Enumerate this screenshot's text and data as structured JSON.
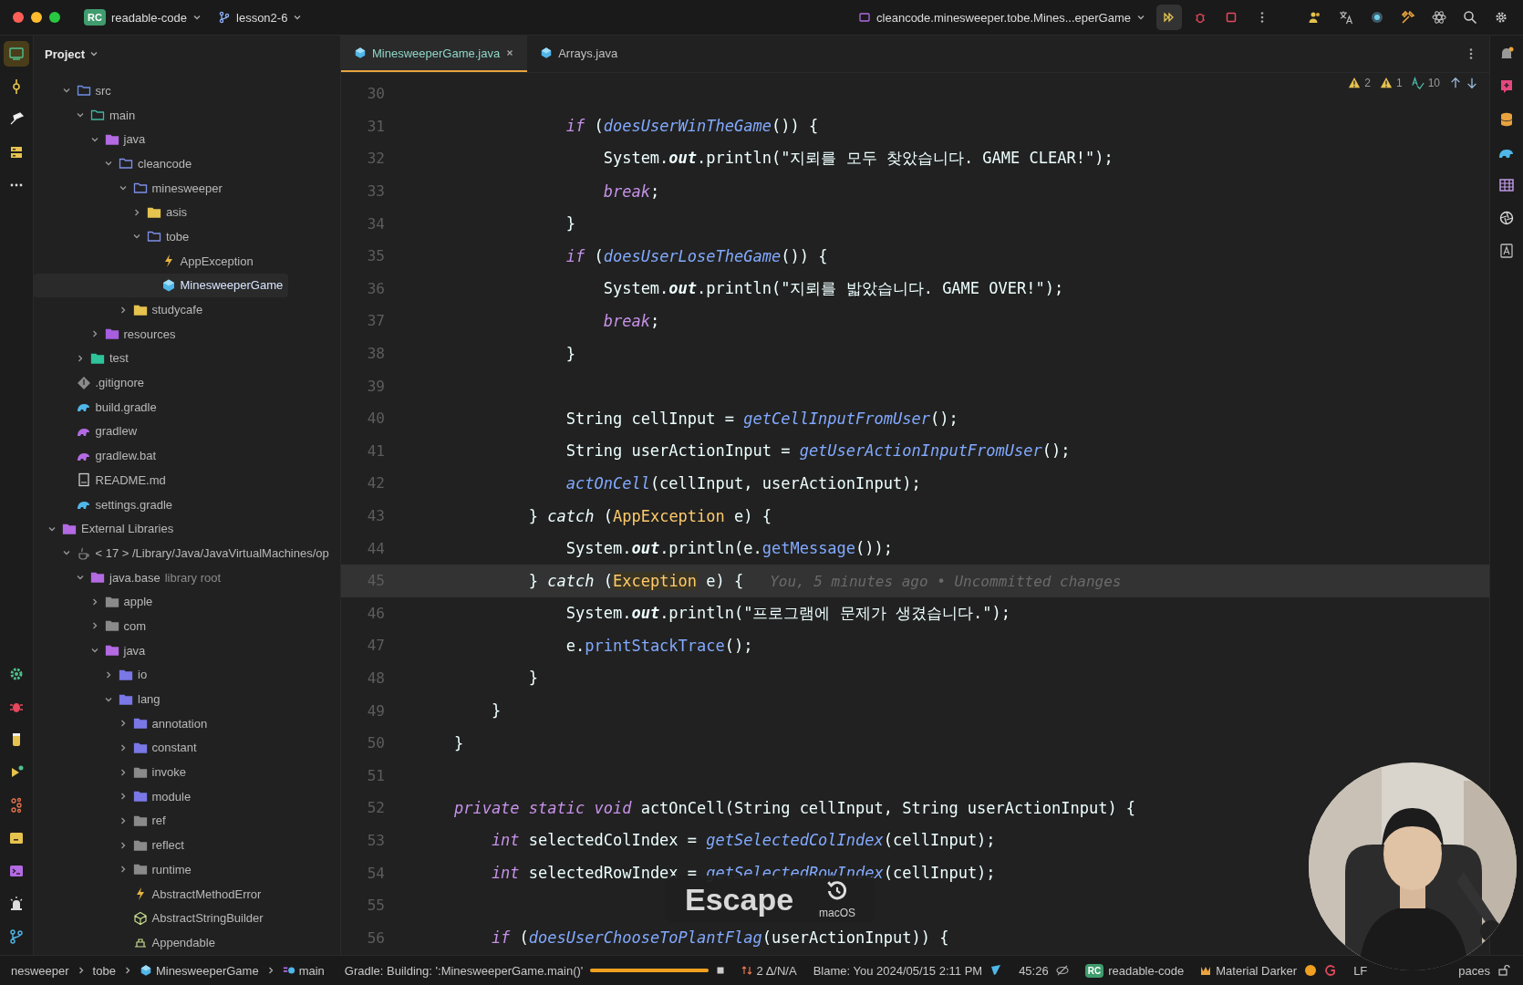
{
  "title_bar": {
    "project_badge": "RC",
    "project": "readable-code",
    "branch": "lesson2-6",
    "run_config": "cleancode.minesweeper.tobe.Mines...eperGame"
  },
  "sidebar": {
    "title": "Project",
    "project_items": [
      {
        "label": "src",
        "kind": "source-root",
        "expanded": true,
        "selected": false,
        "children": [
          {
            "label": "main",
            "kind": "module",
            "expanded": true,
            "selected": false,
            "children": [
              {
                "label": "java",
                "kind": "java-sources",
                "expanded": true,
                "selected": false,
                "children": [
                  {
                    "label": "cleancode",
                    "kind": "package",
                    "expanded": true,
                    "selected": false,
                    "children": [
                      {
                        "label": "minesweeper",
                        "kind": "package",
                        "expanded": true,
                        "selected": false,
                        "children": [
                          {
                            "label": "asis",
                            "kind": "folder",
                            "expanded": false,
                            "selected": false
                          },
                          {
                            "label": "tobe",
                            "kind": "package",
                            "expanded": true,
                            "selected": false,
                            "children": [
                              {
                                "label": "AppException",
                                "kind": "exception",
                                "selected": false
                              },
                              {
                                "label": "MinesweeperGame",
                                "kind": "class",
                                "selected": true
                              }
                            ]
                          }
                        ]
                      },
                      {
                        "label": "studycafe",
                        "kind": "folder",
                        "expanded": false,
                        "selected": false
                      }
                    ]
                  }
                ]
              },
              {
                "label": "resources",
                "kind": "resources",
                "expanded": false,
                "selected": false
              }
            ]
          },
          {
            "label": "test",
            "kind": "test-root",
            "expanded": false,
            "selected": false
          }
        ]
      },
      {
        "label": ".gitignore",
        "kind": "gitignore",
        "selected": false
      },
      {
        "label": "build.gradle",
        "kind": "gradle",
        "selected": false
      },
      {
        "label": "gradlew",
        "kind": "script",
        "selected": false
      },
      {
        "label": "gradlew.bat",
        "kind": "script",
        "selected": false
      },
      {
        "label": "README.md",
        "kind": "readme",
        "selected": false
      },
      {
        "label": "settings.gradle",
        "kind": "gradle",
        "selected": false
      }
    ],
    "external_libraries": {
      "label": "External Libraries",
      "kind": "libraries",
      "expanded": true,
      "selected": false,
      "children": [
        {
          "label": "< 17 > /Library/Java/JavaVirtualMachines/op",
          "kind": "sdk",
          "expanded": true,
          "selected": false,
          "children": [
            {
              "label": "java.base",
              "secondary": "library root",
              "kind": "library-root",
              "expanded": true,
              "selected": false,
              "children": [
                {
                  "label": "apple",
                  "kind": "lib-package",
                  "expanded": false,
                  "selected": false
                },
                {
                  "label": "com",
                  "kind": "lib-package",
                  "expanded": false,
                  "selected": false
                },
                {
                  "label": "java",
                  "kind": "java-sources",
                  "expanded": true,
                  "selected": false,
                  "children": [
                    {
                      "label": "io",
                      "kind": "exported",
                      "expanded": false,
                      "selected": false
                    },
                    {
                      "label": "lang",
                      "kind": "exported",
                      "expanded": true,
                      "selected": false,
                      "children": [
                        {
                          "label": "annotation",
                          "kind": "exported",
                          "expanded": false,
                          "selected": false
                        },
                        {
                          "label": "constant",
                          "kind": "exported",
                          "expanded": false,
                          "selected": false
                        },
                        {
                          "label": "invoke",
                          "kind": "lib-package",
                          "expanded": false,
                          "selected": false
                        },
                        {
                          "label": "module",
                          "kind": "exported",
                          "expanded": false,
                          "selected": false
                        },
                        {
                          "label": "ref",
                          "kind": "lib-package",
                          "expanded": false,
                          "selected": false
                        },
                        {
                          "label": "reflect",
                          "kind": "lib-package",
                          "expanded": false,
                          "selected": false
                        },
                        {
                          "label": "runtime",
                          "kind": "lib-package",
                          "expanded": false,
                          "selected": false
                        },
                        {
                          "label": "AbstractMethodError",
                          "kind": "exception",
                          "selected": false
                        },
                        {
                          "label": "AbstractStringBuilder",
                          "kind": "abstract",
                          "selected": false
                        },
                        {
                          "label": "Appendable",
                          "kind": "interface",
                          "selected": false
                        }
                      ]
                    }
                  ]
                }
              ]
            }
          ]
        }
      ]
    }
  },
  "tabs": [
    {
      "label": "MinesweeperGame.java",
      "selected": true,
      "closable": true
    },
    {
      "label": "Arrays.java",
      "selected": false,
      "closable": false
    }
  ],
  "inspections": {
    "warnings": "2",
    "weak_warnings": "1",
    "typos": "10"
  },
  "code": {
    "lines": [
      {
        "number": "30",
        "current": false
      },
      {
        "number": "31",
        "current": false,
        "tokens": [
          {
            "t": "                if",
            "kind": "keyword"
          },
          {
            "t": " (",
            "kind": "plain"
          },
          {
            "t": "doesUserWinTheGame",
            "kind": "method"
          },
          {
            "t": "()) {",
            "kind": "plain"
          }
        ]
      },
      {
        "number": "32",
        "current": false,
        "tokens": [
          {
            "t": "                    System.",
            "kind": "plain"
          },
          {
            "t": "out",
            "kind": "field"
          },
          {
            "t": ".println(",
            "kind": "plain"
          },
          {
            "t": "\"지뢰를 모두 찾았습니다. GAME CLEAR!\"",
            "kind": "string"
          },
          {
            "t": ");",
            "kind": "plain"
          }
        ]
      },
      {
        "number": "33",
        "current": false,
        "tokens": [
          {
            "t": "                    break",
            "kind": "keyword"
          },
          {
            "t": ";",
            "kind": "plain"
          }
        ]
      },
      {
        "number": "34",
        "current": false,
        "tokens": [
          {
            "t": "                }",
            "kind": "plain"
          }
        ]
      },
      {
        "number": "35",
        "current": false,
        "tokens": [
          {
            "t": "                if",
            "kind": "keyword"
          },
          {
            "t": " (",
            "kind": "plain"
          },
          {
            "t": "doesUserLoseTheGame",
            "kind": "method"
          },
          {
            "t": "()) {",
            "kind": "plain"
          }
        ]
      },
      {
        "number": "36",
        "current": false,
        "tokens": [
          {
            "t": "                    System.",
            "kind": "plain"
          },
          {
            "t": "out",
            "kind": "field"
          },
          {
            "t": ".println(",
            "kind": "plain"
          },
          {
            "t": "\"지뢰를 밟았습니다. GAME OVER!\"",
            "kind": "string"
          },
          {
            "t": ");",
            "kind": "plain"
          }
        ]
      },
      {
        "number": "37",
        "current": false,
        "tokens": [
          {
            "t": "                    break",
            "kind": "keyword"
          },
          {
            "t": ";",
            "kind": "plain"
          }
        ]
      },
      {
        "number": "38",
        "current": false,
        "tokens": [
          {
            "t": "                }",
            "kind": "plain"
          }
        ]
      },
      {
        "number": "39",
        "current": false
      },
      {
        "number": "40",
        "current": false,
        "tokens": [
          {
            "t": "                String cellInput = ",
            "kind": "plain"
          },
          {
            "t": "getCellInputFromUser",
            "kind": "method"
          },
          {
            "t": "();",
            "kind": "plain"
          }
        ]
      },
      {
        "number": "41",
        "current": false,
        "tokens": [
          {
            "t": "                String userActionInput = ",
            "kind": "plain"
          },
          {
            "t": "getUserActionInputFromUser",
            "kind": "method"
          },
          {
            "t": "();",
            "kind": "plain"
          }
        ]
      },
      {
        "number": "42",
        "current": false,
        "tokens": [
          {
            "t": "                actOnCell",
            "kind": "method"
          },
          {
            "t": "(cellInput, userActionInput);",
            "kind": "plain"
          }
        ]
      },
      {
        "number": "43",
        "current": false,
        "tokens": [
          {
            "t": "            } ",
            "kind": "plain"
          },
          {
            "t": "catch",
            "kind": "control"
          },
          {
            "t": " (",
            "kind": "plain"
          },
          {
            "t": "AppException",
            "kind": "type"
          },
          {
            "t": " e) {",
            "kind": "plain"
          }
        ]
      },
      {
        "number": "44",
        "current": false,
        "tokens": [
          {
            "t": "                System.",
            "kind": "plain"
          },
          {
            "t": "out",
            "kind": "field"
          },
          {
            "t": ".println(e.",
            "kind": "plain"
          },
          {
            "t": "getMessage",
            "kind": "call"
          },
          {
            "t": "());",
            "kind": "plain"
          }
        ]
      },
      {
        "number": "45",
        "current": true,
        "tokens": [
          {
            "t": "            } ",
            "kind": "plain"
          },
          {
            "t": "catch",
            "kind": "control"
          },
          {
            "t": " (",
            "kind": "plain"
          },
          {
            "t": "Exception",
            "kind": "match"
          },
          {
            "t": " e) {",
            "kind": "plain"
          },
          {
            "t": "   You, 5 minutes ago • Uncommitted changes",
            "kind": "inlay"
          }
        ]
      },
      {
        "number": "46",
        "current": false,
        "tokens": [
          {
            "t": "                System.",
            "kind": "plain"
          },
          {
            "t": "out",
            "kind": "field"
          },
          {
            "t": ".println(",
            "kind": "plain"
          },
          {
            "t": "\"프로그램에 문제가 생겼습니다.\"",
            "kind": "string"
          },
          {
            "t": ");",
            "kind": "plain"
          }
        ]
      },
      {
        "number": "47",
        "current": false,
        "tokens": [
          {
            "t": "                e.",
            "kind": "plain"
          },
          {
            "t": "printStackTrace",
            "kind": "call"
          },
          {
            "t": "();",
            "kind": "plain"
          }
        ]
      },
      {
        "number": "48",
        "current": false,
        "tokens": [
          {
            "t": "            }",
            "kind": "plain"
          }
        ]
      },
      {
        "number": "49",
        "current": false,
        "tokens": [
          {
            "t": "        }",
            "kind": "plain"
          }
        ]
      },
      {
        "number": "50",
        "current": false,
        "tokens": [
          {
            "t": "    }",
            "kind": "plain"
          }
        ]
      },
      {
        "number": "51",
        "current": false
      },
      {
        "number": "52",
        "current": false,
        "tokens": [
          {
            "t": "    private static void",
            "kind": "keyword"
          },
          {
            "t": " actOnCell(String cellInput, String userActionInput) {",
            "kind": "plain"
          }
        ]
      },
      {
        "number": "53",
        "current": false,
        "tokens": [
          {
            "t": "        int",
            "kind": "keyword"
          },
          {
            "t": " selectedColIndex = ",
            "kind": "plain"
          },
          {
            "t": "getSelectedColIndex",
            "kind": "method"
          },
          {
            "t": "(cellInput);",
            "kind": "plain"
          }
        ]
      },
      {
        "number": "54",
        "current": false,
        "tokens": [
          {
            "t": "        int",
            "kind": "keyword"
          },
          {
            "t": " selectedRowIndex = ",
            "kind": "plain"
          },
          {
            "t": "getSelectedRowIndex",
            "kind": "method"
          },
          {
            "t": "(cellInput);",
            "kind": "plain"
          }
        ]
      },
      {
        "number": "55",
        "current": false
      },
      {
        "number": "56",
        "current": false,
        "tokens": [
          {
            "t": "        if",
            "kind": "keyword"
          },
          {
            "t": " (",
            "kind": "plain"
          },
          {
            "t": "doesUserChooseToPlantFlag",
            "kind": "method"
          },
          {
            "t": "(userActionInput)) {",
            "kind": "plain"
          }
        ]
      }
    ]
  },
  "key_overlay": {
    "key": "Escape",
    "layout": "macOS"
  },
  "status_bar": {
    "breadcrumbs": [
      {
        "label": "nesweeper",
        "kind": "package"
      },
      {
        "label": "tobe",
        "kind": "package"
      },
      {
        "label": "MinesweeperGame",
        "kind": "class"
      },
      {
        "label": "main",
        "kind": "method"
      }
    ],
    "task": "Gradle: Building: ':MinesweeperGame.main()'",
    "progress": {
      "level": 1
    },
    "vcs_changes": "2 Δ/N/A",
    "blame": "Blame: You 2024/05/15 2:11 PM",
    "position": "45:26",
    "project_badge": "RC",
    "project": "readable-code",
    "theme": "Material Darker",
    "line_separator": "LF",
    "indent": "paces"
  }
}
